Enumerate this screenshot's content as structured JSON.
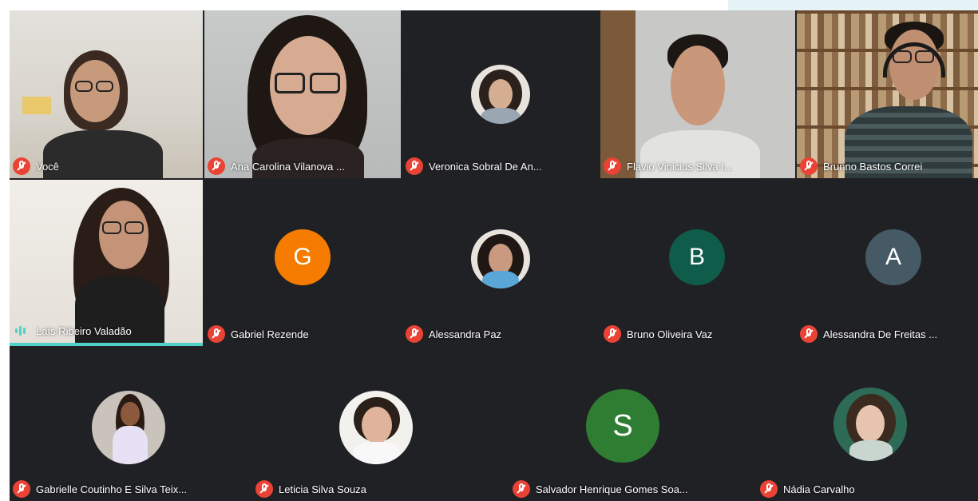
{
  "meeting": {
    "row1": [
      {
        "id": "voce",
        "name": "Você"
      },
      {
        "id": "ana",
        "name": "Ana Carolina Vilanova ..."
      },
      {
        "id": "veronica",
        "name": "Veronica Sobral De An..."
      },
      {
        "id": "flavio",
        "name": "Flavio Vinicius Silva I..."
      },
      {
        "id": "brunno",
        "name": "Brunno Bastos Correi"
      }
    ],
    "row2": [
      {
        "id": "lais",
        "name": "Laís Ribeiro Valadão"
      },
      {
        "id": "gabriel",
        "name": "Gabriel Rezende",
        "initial": "G"
      },
      {
        "id": "alessandra-paz",
        "name": "Alessandra Paz"
      },
      {
        "id": "bruno-vaz",
        "name": "Bruno Oliveira Vaz",
        "initial": "B"
      },
      {
        "id": "alessandra-freitas",
        "name": "Alessandra De Freitas ...",
        "initial": "A"
      }
    ],
    "row3": [
      {
        "id": "gabrielle",
        "name": "Gabrielle Coutinho E Silva Teix..."
      },
      {
        "id": "leticia",
        "name": "Leticia Silva Souza"
      },
      {
        "id": "salvador",
        "name": "Salvador Henrique Gomes Soa...",
        "initial": "S"
      },
      {
        "id": "nadia",
        "name": "Nádia Carvalho"
      }
    ]
  },
  "colors": {
    "background": "#202124",
    "mic_muted": "#ea4335",
    "avatar_gabriel": "#f57c00",
    "avatar_bruno": "#0f5c4a",
    "avatar_alessandra": "#455a64",
    "avatar_salvador": "#2e7d32",
    "speaking_indicator": "#4fd1c5"
  },
  "icons": {
    "muted": "mic-off-icon",
    "speaking": "audio-level-icon"
  }
}
